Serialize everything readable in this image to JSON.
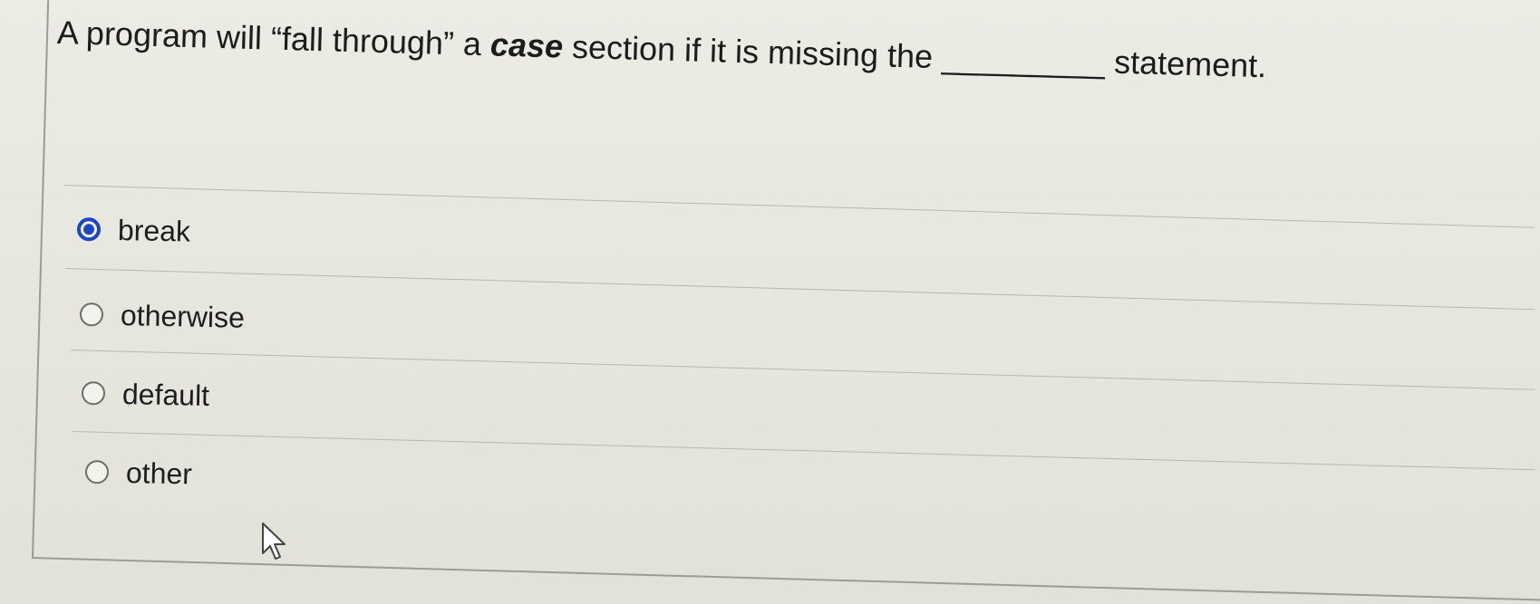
{
  "question": {
    "before": "A program will “fall through” a ",
    "emphasis": "case",
    "after": " section if it is missing the ",
    "blank": "_________",
    "end": " statement."
  },
  "options": [
    {
      "label": "break",
      "selected": true
    },
    {
      "label": "otherwise",
      "selected": false
    },
    {
      "label": "default",
      "selected": false
    },
    {
      "label": "other",
      "selected": false
    }
  ],
  "colors": {
    "accent": "#1c46c8",
    "background": "#e6e6de"
  },
  "icons": {
    "cursor": "mouse-pointer-icon"
  }
}
